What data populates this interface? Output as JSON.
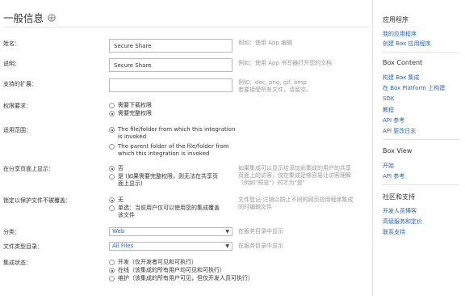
{
  "page": {
    "title": "一般信息"
  },
  "form": {
    "name": {
      "label": "姓名：",
      "value": "Secure Share",
      "help": "例如：使用 App 编辑"
    },
    "description": {
      "label": "说明：",
      "value": "Secure Share",
      "help": "例如：使用 App 书写器打开您的文档"
    },
    "extensions": {
      "label": "支持的扩展：",
      "value": "",
      "help_line1": "例如：doc, png, gif, bmp",
      "help_line2": "若要接受所有文件，请留空。"
    },
    "permissions": {
      "label": "权限要求：",
      "options": [
        {
          "text": "需要下载权限",
          "selected": false
        },
        {
          "text": "需要完整权限",
          "selected": true
        }
      ]
    },
    "scope": {
      "label": "适用范围：",
      "options": [
        {
          "line1": "The file/folder from which this integration",
          "line2": "is invoked",
          "selected": true
        },
        {
          "line1": "The parent folder of the file/folder from",
          "line2": "which this integration is invoked",
          "selected": false
        }
      ]
    },
    "shared_page": {
      "label": "在分享页面上显示：",
      "options": [
        {
          "text": "否",
          "selected": true
        },
        {
          "text_prefix": "是",
          "line1": "(如果需要完整权限，则无法在共享页",
          "line2": "面上显示)",
          "selected": false
        }
      ],
      "help_line1": "如果集成可以显示给添加此集成的用户的共享",
      "help_line2": "页面上的访客，仅在集成足够容易让访客理解",
      "help_line3": "（例如\"预览\"）时才为\"是\""
    },
    "lock": {
      "label": "锁定以保护文件不被覆盖：",
      "options": [
        {
          "text": "无",
          "selected": true
        },
        {
          "line1": "单选：当前用户仅可以使用您的集成覆盖",
          "line2": "该文件",
          "selected": false
        }
      ],
      "help_line1": "文件登记-注销以防止不同的网页应用程序集成",
      "help_line2": "同时编辑文件"
    },
    "category": {
      "label": "分类：",
      "value": "Web",
      "help": "在服务目录中显示"
    },
    "file_type": {
      "label": "文件类型目录：",
      "value": "All Files",
      "help": "在服务目录中显示"
    },
    "status": {
      "label": "集成状态：",
      "options": [
        {
          "text": "开发（仅开发者可见和可执行）",
          "selected": false
        },
        {
          "text": "在线（该集成的所有用户均可见和可执行）",
          "selected": true
        },
        {
          "text": "维护（该集成的所有用户可见，但仅开发人员可执行）",
          "selected": false
        }
      ]
    }
  },
  "sidebar": {
    "apps": {
      "heading": "应用程序",
      "links": [
        "我的应用程序",
        "创建 Box 应用程序"
      ]
    },
    "content": {
      "heading": "Box Content",
      "links": [
        "构建 Box 集成",
        "在 Box Platform 上构建",
        "SDK",
        "教程",
        "API 参考",
        "API 更改日志"
      ]
    },
    "view": {
      "heading": "Box View",
      "links": [
        "开始",
        "API 参考"
      ]
    },
    "community": {
      "heading": "社区和支持",
      "links": [
        "开发人员博客",
        "高级服务和定价",
        "联系支持"
      ]
    }
  },
  "colors": {
    "link": "#2a66b0",
    "muted": "#999999",
    "text": "#333333",
    "border": "#b9b9b9"
  },
  "icons": {
    "header": "move-icon",
    "select": "chevron-down-icon"
  }
}
